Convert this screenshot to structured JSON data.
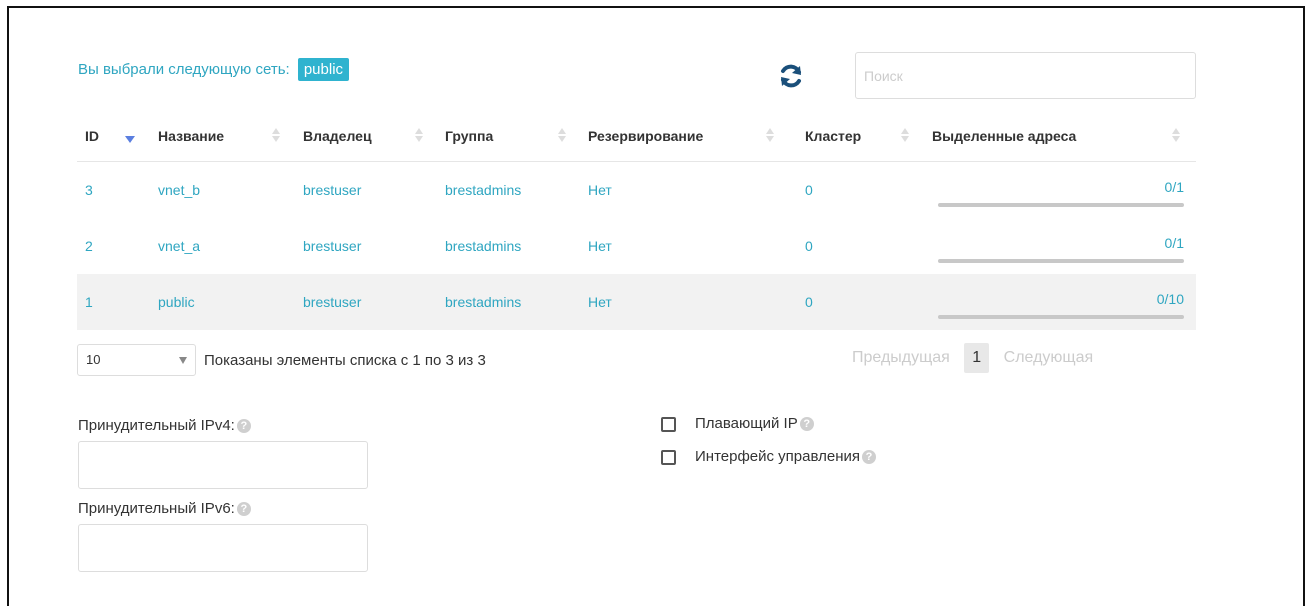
{
  "selection": {
    "label": "Вы выбрали следующую сеть:",
    "network": "public"
  },
  "search": {
    "placeholder": "Поиск",
    "value": ""
  },
  "table": {
    "columns": [
      "ID",
      "Название",
      "Владелец",
      "Группа",
      "Резервирование",
      "Кластер",
      "Выделенные адреса"
    ],
    "sorted_column": "ID",
    "rows": [
      {
        "id": "3",
        "name": "vnet_b",
        "owner": "brestuser",
        "group": "brestadmins",
        "reservation": "Нет",
        "cluster": "0",
        "leases": "0/1",
        "lease_fraction": 0,
        "selected": false
      },
      {
        "id": "2",
        "name": "vnet_a",
        "owner": "brestuser",
        "group": "brestadmins",
        "reservation": "Нет",
        "cluster": "0",
        "leases": "0/1",
        "lease_fraction": 0,
        "selected": false
      },
      {
        "id": "1",
        "name": "public",
        "owner": "brestuser",
        "group": "brestadmins",
        "reservation": "Нет",
        "cluster": "0",
        "leases": "0/10",
        "lease_fraction": 0,
        "selected": true
      }
    ]
  },
  "pagination": {
    "page_size": "10",
    "info": "Показаны элементы списка с 1 по 3 из 3",
    "prev": "Предыдущая",
    "current": "1",
    "next": "Следующая"
  },
  "form": {
    "ipv4_label": "Принудительный IPv4:",
    "ipv6_label": "Принудительный IPv6:",
    "floating_ip_label": "Плавающий IP",
    "mgmt_iface_label": "Интерфейс управления"
  },
  "colors": {
    "accent": "#2fa6c1",
    "badge": "#2fb3cf",
    "refresh": "#1a4f7a",
    "sort_active": "#5b7fe0"
  }
}
